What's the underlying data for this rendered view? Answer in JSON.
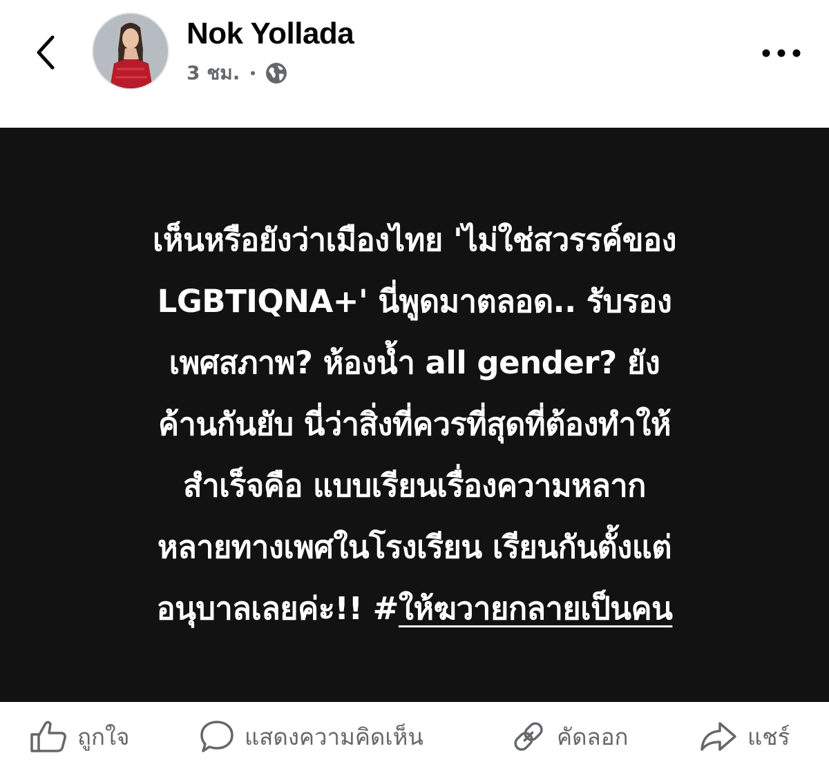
{
  "header": {
    "author_name": "Nok Yollada",
    "timestamp": "3 ชม.",
    "privacy_icon": "globe-icon",
    "back_icon": "chevron-left-icon",
    "more_icon": "more-horizontal-icon"
  },
  "post": {
    "background_color": "#121212",
    "text_color": "#ffffff",
    "lines": [
      "เห็นหรือยังว่าเมืองไทย 'ไม่ใช่สวรรค์ของ",
      "LGBTIQNA+' นี่พูดมาตลอด.. รับรอง",
      "เพศสภาพ? ห้องน้ำ all gender? ยัง",
      "ค้านกันยับ นี่ว่าสิ่งที่ควรที่สุดที่ต้องทำให้",
      "สำเร็จคือ แบบเรียนเรื่องความหลาก",
      "หลายทางเพศในโรงเรียน เรียนกันตั้งแต่",
      "อนุบาลเลยค่ะ!! "
    ],
    "hashtag_symbol": "#",
    "hashtag_text": "ให้ฆวายกลายเป็นคน"
  },
  "actions": {
    "like_label": "ถูกใจ",
    "comment_label": "แสดงความคิดเห็น",
    "copy_label": "คัดลอก",
    "share_label": "แชร์",
    "icon_color": "#65676b"
  }
}
